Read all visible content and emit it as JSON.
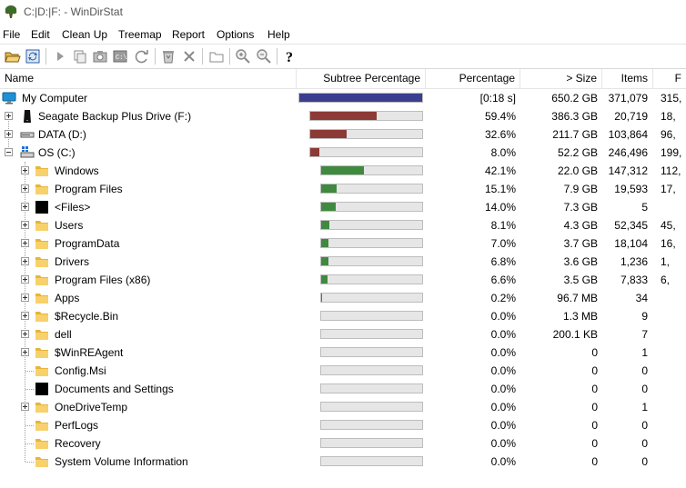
{
  "window": {
    "title": "C:|D:|F: - WinDirStat"
  },
  "menu": [
    "File",
    "Edit",
    "Clean Up",
    "Treemap",
    "Report",
    "Options",
    "Help"
  ],
  "toolbar": [
    "open-folder-icon",
    "refresh-icon",
    "play-icon",
    "copy-icon",
    "camera-icon",
    "command-icon",
    "refresh-selected-icon",
    "recycle-icon",
    "delete-icon",
    "new-folder-icon",
    "zoom-in-icon",
    "zoom-out-icon",
    "help-icon"
  ],
  "columns": {
    "name": "Name",
    "subtree": "Subtree Percentage",
    "percentage": "Percentage",
    "size": "> Size",
    "items": "Items",
    "files": "F"
  },
  "colors": {
    "root_bar": "#3b3e8f",
    "drive_bar": "#8c3a36",
    "folder_bar": "#3f8a3f"
  },
  "rows": [
    {
      "name": "My Computer",
      "icon": "computer-icon",
      "level": 0,
      "expander": "none",
      "bar": 1.0,
      "bar_color": "root",
      "percentage": "[0:18 s]",
      "size": "650.2 GB",
      "items": "371,079",
      "files": "315,"
    },
    {
      "name": "Seagate Backup Plus Drive (F:)",
      "icon": "external-drive-icon",
      "level": 1,
      "expander": "plus",
      "bar": 0.594,
      "bar_color": "drive",
      "percentage": "59.4%",
      "size": "386.3 GB",
      "items": "20,719",
      "files": "18,"
    },
    {
      "name": "DATA (D:)",
      "icon": "drive-icon",
      "level": 1,
      "expander": "plus",
      "bar": 0.326,
      "bar_color": "drive",
      "percentage": "32.6%",
      "size": "211.7 GB",
      "items": "103,864",
      "files": "96,"
    },
    {
      "name": "OS (C:)",
      "icon": "os-drive-icon",
      "level": 1,
      "expander": "minus",
      "bar": 0.08,
      "bar_color": "drive",
      "percentage": "8.0%",
      "size": "52.2 GB",
      "items": "246,496",
      "files": "199,"
    },
    {
      "name": "Windows",
      "icon": "folder-icon",
      "level": 2,
      "expander": "plus",
      "bar": 0.421,
      "bar_color": "folder",
      "percentage": "42.1%",
      "size": "22.0 GB",
      "items": "147,312",
      "files": "112,"
    },
    {
      "name": "Program Files",
      "icon": "folder-icon",
      "level": 2,
      "expander": "plus",
      "bar": 0.151,
      "bar_color": "folder",
      "percentage": "15.1%",
      "size": "7.9 GB",
      "items": "19,593",
      "files": "17,"
    },
    {
      "name": "<Files>",
      "icon": "files-icon",
      "level": 2,
      "expander": "plus",
      "bar": 0.14,
      "bar_color": "folder",
      "percentage": "14.0%",
      "size": "7.3 GB",
      "items": "5",
      "files": ""
    },
    {
      "name": "Users",
      "icon": "folder-icon",
      "level": 2,
      "expander": "plus",
      "bar": 0.081,
      "bar_color": "folder",
      "percentage": "8.1%",
      "size": "4.3 GB",
      "items": "52,345",
      "files": "45,"
    },
    {
      "name": "ProgramData",
      "icon": "folder-icon",
      "level": 2,
      "expander": "plus",
      "bar": 0.07,
      "bar_color": "folder",
      "percentage": "7.0%",
      "size": "3.7 GB",
      "items": "18,104",
      "files": "16,"
    },
    {
      "name": "Drivers",
      "icon": "folder-icon",
      "level": 2,
      "expander": "plus",
      "bar": 0.068,
      "bar_color": "folder",
      "percentage": "6.8%",
      "size": "3.6 GB",
      "items": "1,236",
      "files": "1,"
    },
    {
      "name": "Program Files (x86)",
      "icon": "folder-icon",
      "level": 2,
      "expander": "plus",
      "bar": 0.066,
      "bar_color": "folder",
      "percentage": "6.6%",
      "size": "3.5 GB",
      "items": "7,833",
      "files": "6,"
    },
    {
      "name": "Apps",
      "icon": "folder-icon",
      "level": 2,
      "expander": "plus",
      "bar": 0.002,
      "bar_color": "folder",
      "percentage": "0.2%",
      "size": "96.7 MB",
      "items": "34",
      "files": ""
    },
    {
      "name": "$Recycle.Bin",
      "icon": "folder-icon",
      "level": 2,
      "expander": "plus",
      "bar": 0,
      "bar_color": "folder",
      "percentage": "0.0%",
      "size": "1.3 MB",
      "items": "9",
      "files": ""
    },
    {
      "name": "dell",
      "icon": "folder-icon",
      "level": 2,
      "expander": "plus",
      "bar": 0,
      "bar_color": "folder",
      "percentage": "0.0%",
      "size": "200.1 KB",
      "items": "7",
      "files": ""
    },
    {
      "name": "$WinREAgent",
      "icon": "folder-icon",
      "level": 2,
      "expander": "plus",
      "bar": 0,
      "bar_color": "folder",
      "percentage": "0.0%",
      "size": "0",
      "items": "1",
      "files": ""
    },
    {
      "name": "Config.Msi",
      "icon": "folder-icon",
      "level": 2,
      "expander": "none",
      "bar": 0,
      "bar_color": "folder",
      "percentage": "0.0%",
      "size": "0",
      "items": "0",
      "files": ""
    },
    {
      "name": "Documents and Settings",
      "icon": "files-icon",
      "level": 2,
      "expander": "none",
      "bar": 0,
      "bar_color": "folder",
      "percentage": "0.0%",
      "size": "0",
      "items": "0",
      "files": ""
    },
    {
      "name": "OneDriveTemp",
      "icon": "folder-icon",
      "level": 2,
      "expander": "plus",
      "bar": 0,
      "bar_color": "folder",
      "percentage": "0.0%",
      "size": "0",
      "items": "1",
      "files": ""
    },
    {
      "name": "PerfLogs",
      "icon": "folder-icon",
      "level": 2,
      "expander": "none",
      "bar": 0,
      "bar_color": "folder",
      "percentage": "0.0%",
      "size": "0",
      "items": "0",
      "files": ""
    },
    {
      "name": "Recovery",
      "icon": "folder-icon",
      "level": 2,
      "expander": "none",
      "bar": 0,
      "bar_color": "folder",
      "percentage": "0.0%",
      "size": "0",
      "items": "0",
      "files": ""
    },
    {
      "name": "System Volume Information",
      "icon": "folder-icon",
      "level": 2,
      "expander": "none",
      "bar": 0,
      "bar_color": "folder",
      "percentage": "0.0%",
      "size": "0",
      "items": "0",
      "files": ""
    }
  ]
}
